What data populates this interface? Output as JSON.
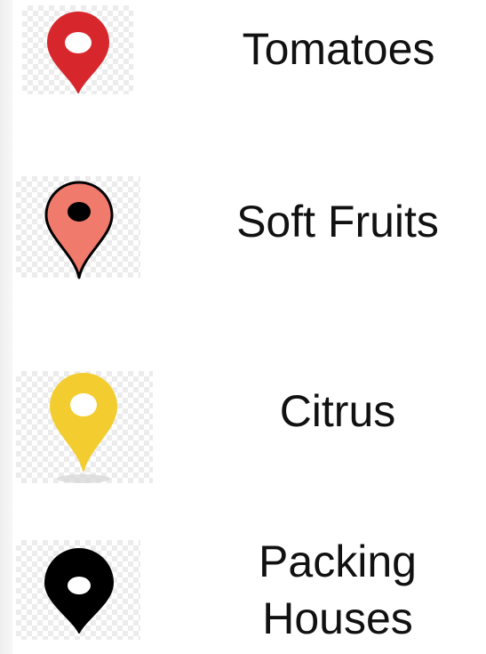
{
  "legend": {
    "items": [
      {
        "label": "Tomatoes",
        "icon": "map-pin-icon",
        "pin_color": "#d7272c",
        "outline_color": "#d7272c",
        "hole_color": "#ffffff"
      },
      {
        "label": "Soft Fruits",
        "icon": "map-pin-icon",
        "pin_color": "#f07a6c",
        "outline_color": "#000000",
        "hole_color": "#000000"
      },
      {
        "label": "Citrus",
        "icon": "map-pin-icon",
        "pin_color": "#f3cd30",
        "outline_color": "#f3cd30",
        "hole_color": "#ffffff"
      },
      {
        "label_lines": [
          "Packing",
          "Houses"
        ],
        "icon": "map-pin-icon",
        "pin_color": "#000000",
        "outline_color": "#000000",
        "hole_color": "#ffffff"
      }
    ]
  }
}
